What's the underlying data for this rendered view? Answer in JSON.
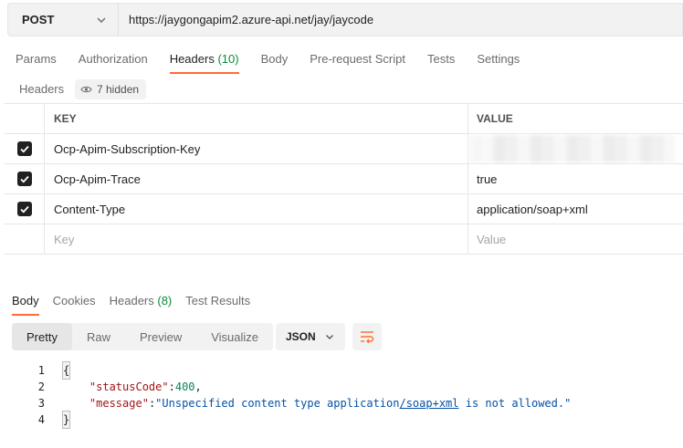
{
  "request": {
    "method": "POST",
    "url": "https://jaygongapim2.azure-api.net/jay/jaycode"
  },
  "request_tabs": [
    {
      "label": "Params"
    },
    {
      "label": "Authorization"
    },
    {
      "label": "Headers",
      "count": "(10)",
      "active": true
    },
    {
      "label": "Body"
    },
    {
      "label": "Pre-request Script"
    },
    {
      "label": "Tests"
    },
    {
      "label": "Settings"
    }
  ],
  "headers_section": {
    "label": "Headers",
    "hidden_label": "7 hidden",
    "columns": {
      "key": "KEY",
      "value": "VALUE"
    },
    "rows": [
      {
        "key": "Ocp-Apim-Subscription-Key",
        "value": "",
        "checked": true,
        "value_redacted": true
      },
      {
        "key": "Ocp-Apim-Trace",
        "value": "true",
        "checked": true
      },
      {
        "key": "Content-Type",
        "value": "application/soap+xml",
        "checked": true
      }
    ],
    "new_row": {
      "key_placeholder": "Key",
      "value_placeholder": "Value"
    }
  },
  "response_tabs": [
    {
      "label": "Body",
      "active": true
    },
    {
      "label": "Cookies"
    },
    {
      "label": "Headers",
      "count": "(8)"
    },
    {
      "label": "Test Results"
    }
  ],
  "view_modes": [
    "Pretty",
    "Raw",
    "Preview",
    "Visualize"
  ],
  "active_view": "Pretty",
  "format": "JSON",
  "response_body": {
    "line_numbers": [
      "1",
      "2",
      "3",
      "4"
    ],
    "open_brace": "{",
    "close_brace": "}",
    "status_key": "\"statusCode\"",
    "status_value": "400",
    "message_key": "\"message\"",
    "message_value_pre": "\"Unspecified content type application",
    "message_value_link": "/soap+xml",
    "message_value_post": " is not allowed.\""
  },
  "colors": {
    "accent": "#ff6c37",
    "count_green": "#0a8a3a",
    "json_key": "#a31515",
    "json_number": "#098658",
    "json_string": "#0451a5"
  }
}
